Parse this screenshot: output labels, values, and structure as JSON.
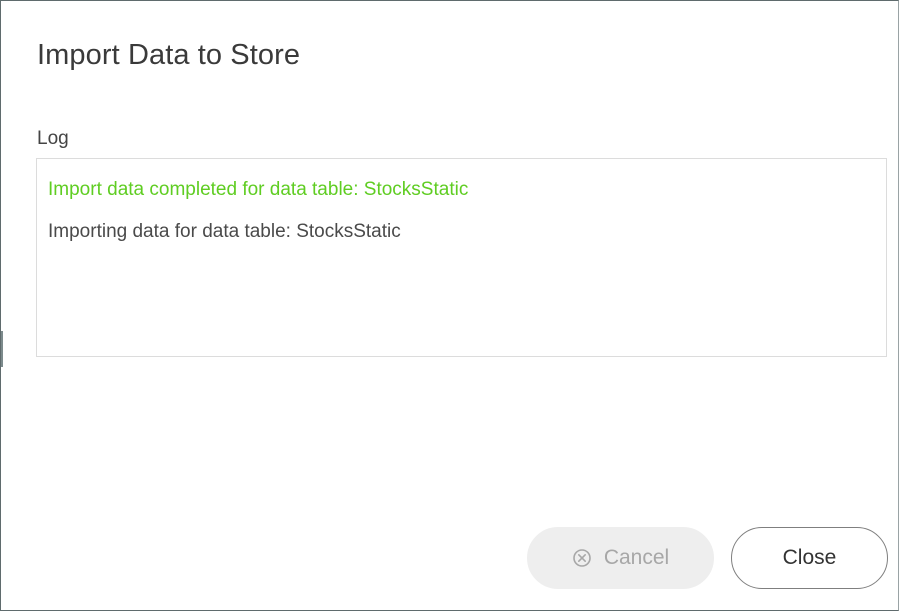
{
  "dialog": {
    "title": "Import Data to Store",
    "log_label": "Log",
    "log_lines": [
      {
        "text": "Import data completed for data table: StocksStatic",
        "color": "#5fcd22"
      },
      {
        "text": "Importing data for data table: StocksStatic",
        "color": "#4a4a4a"
      }
    ]
  },
  "buttons": {
    "cancel": {
      "label": "Cancel",
      "icon": "circle-x-icon",
      "enabled": false
    },
    "close": {
      "label": "Close",
      "enabled": true
    }
  }
}
